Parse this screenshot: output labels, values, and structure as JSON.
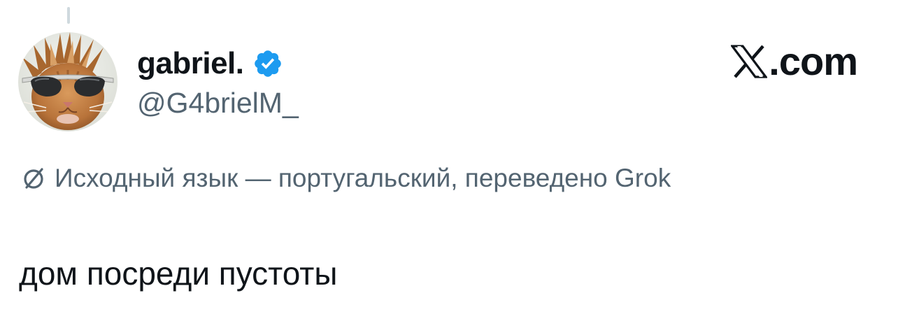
{
  "post": {
    "author": {
      "display_name": "gabriel.",
      "handle": "@G4brielM_",
      "verified": true,
      "avatar_icon": "cat-with-sunglasses-avatar"
    },
    "site_mark": {
      "icon": "x-logo-icon",
      "text": ".com"
    },
    "translation_note": "Исходный язык — португальский, переведено Grok",
    "text": "дом посреди пустоты"
  },
  "colors": {
    "text_primary": "#0f1419",
    "text_secondary": "#536471",
    "verified_blue": "#1d9bf0",
    "thread_line": "#cfd9de",
    "background": "#ffffff"
  }
}
